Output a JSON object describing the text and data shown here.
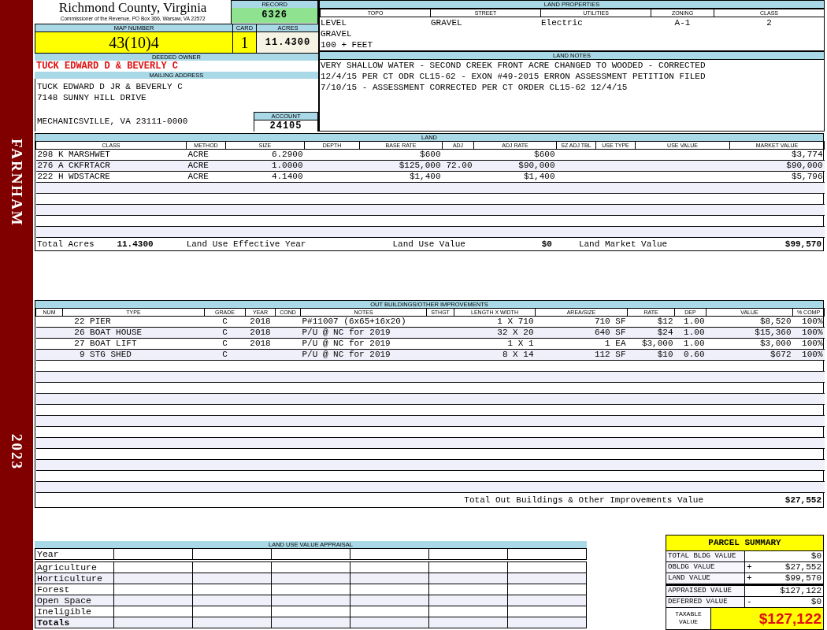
{
  "sidebar": {
    "district": "FARNHAM",
    "year": "2023"
  },
  "header": {
    "county": "Richmond County, Virginia",
    "subtitle": "Commissioner of the Revenue, PO Box 366, Warsaw, VA 22572"
  },
  "record": {
    "label": "RECORD",
    "value": "6326"
  },
  "map_number": {
    "label": "MAP NUMBER",
    "value": "43(10)4"
  },
  "card": {
    "label": "CARD",
    "value": "1"
  },
  "acres": {
    "label": "ACRES",
    "value": "11.4300"
  },
  "deeded_owner": {
    "label": "DEEDED OWNER",
    "value": "TUCK EDWARD D & BEVERLY C"
  },
  "mailing_address": {
    "label": "MAILING ADDRESS",
    "lines": [
      "TUCK EDWARD D JR & BEVERLY C",
      "7148 SUNNY HILL DRIVE"
    ],
    "city_line": "MECHANICSVILLE, VA 23111-0000"
  },
  "account": {
    "label": "ACCOUNT",
    "value": "24105"
  },
  "land_properties": {
    "title": "LAND PROPERTIES",
    "columns": [
      "TOPO",
      "STREET",
      "UTILITIES",
      "ZONING",
      "CLASS"
    ],
    "rows": [
      [
        "LEVEL",
        "GRAVEL",
        "Electric",
        "A-1",
        "2"
      ],
      [
        "GRAVEL"
      ],
      [
        "100 + FEET"
      ]
    ]
  },
  "land_notes": {
    "title": "LAND NOTES",
    "lines": [
      "VERY SHALLOW WATER - SECOND CREEK FRONT ACRE CHANGED TO WOODED - CORRECTED",
      "12/4/15 PER CT ODR CL15-62 - EXON #49-2015 ERRON ASSESSMENT PETITION FILED",
      "7/10/15 - ASSESSMENT CORRECTED PER CT ORDER CL15-62 12/4/15"
    ]
  },
  "land": {
    "title": "LAND",
    "columns": [
      "CLASS",
      "METHOD",
      "SIZE",
      "DEPTH",
      "BASE RATE",
      "ADJ",
      "ADJ RATE",
      "SZ ADJ TBL",
      "USE TYPE",
      "USE VALUE",
      "MARKET VALUE"
    ],
    "rows": [
      {
        "class": "298 K MARSHWET",
        "method": "ACRE",
        "size": "6.2900",
        "base_rate": "$600",
        "adj_rate": "$600",
        "market_value": "$3,774"
      },
      {
        "class": "276 A CKFRTACR",
        "method": "ACRE",
        "size": "1.0000",
        "base_rate": "$125,000",
        "adj": "72.00",
        "adj_rate": "$90,000",
        "market_value": "$90,000"
      },
      {
        "class": "222 H WDSTACRE",
        "method": "ACRE",
        "size": "4.1400",
        "base_rate": "$1,400",
        "adj_rate": "$1,400",
        "market_value": "$5,796"
      }
    ],
    "totals": [
      {
        "label": "Total Acres",
        "value": "11.4300"
      },
      {
        "label": "Land Use Effective Year"
      },
      {
        "label": "Land Use Value",
        "value": "$0"
      },
      {
        "label": "Land Market Value",
        "value": "$99,570"
      }
    ]
  },
  "out_buildings": {
    "title": "OUT BUILDINGS/OTHER IMPROVEMENTS",
    "columns": [
      "NUM",
      "TYPE",
      "GRADE",
      "YEAR",
      "COND",
      "NOTES",
      "STHGT",
      "LENGTH X WIDTH",
      "AREA/SIZE",
      "RATE",
      "DEP",
      "VALUE",
      "% COMP"
    ],
    "rows": [
      {
        "num": "22",
        "type": "PIER",
        "grade": "C",
        "year": "2018",
        "notes": "P#11007 (6x65+16x20)",
        "size": "1 X 710",
        "area": "710 SF",
        "rate": "$12",
        "dep": "1.00",
        "value": "$8,520",
        "comp": "100%"
      },
      {
        "num": "26",
        "type": "BOAT HOUSE",
        "grade": "C",
        "year": "2018",
        "notes": "P/U @ NC for 2019",
        "size": "32 X 20",
        "area": "640 SF",
        "rate": "$24",
        "dep": "1.00",
        "value": "$15,360",
        "comp": "100%"
      },
      {
        "num": "27",
        "type": "BOAT LIFT",
        "grade": "C",
        "year": "2018",
        "notes": "P/U @ NC for 2019",
        "size": "1 X 1",
        "area": "1 EA",
        "rate": "$3,000",
        "dep": "1.00",
        "value": "$3,000",
        "comp": "100%"
      },
      {
        "num": "9",
        "type": "STG SHED",
        "grade": "C",
        "notes": "P/U @ NC for 2019",
        "size": "8 X 14",
        "area": "112 SF",
        "rate": "$10",
        "dep": "0.60",
        "value": "$672",
        "comp": "100%"
      }
    ],
    "total_label": "Total Out Buildings & Other Improvements Value",
    "total_value": "$27,552"
  },
  "land_use_value_appraisal": {
    "title": "LAND USE VALUE APPRAISAL",
    "year_label": "Year",
    "categories": [
      "Agriculture",
      "Horticulture",
      "Forest",
      "Open Space",
      "Ineligible"
    ],
    "totals_label": "Totals"
  },
  "parcel_summary": {
    "title": "PARCEL SUMMARY",
    "rows": [
      {
        "label": "TOTAL BLDG VALUE",
        "sign": "",
        "value": "$0"
      },
      {
        "label": "OBLDG VALUE",
        "sign": "+",
        "value": "$27,552"
      },
      {
        "label": "LAND VALUE",
        "sign": "+",
        "value": "$99,570"
      },
      {
        "label": "APPRAISED VALUE",
        "sign": "",
        "value": "$127,122"
      },
      {
        "label": "DEFERRED VALUE",
        "sign": "-",
        "value": "$0"
      }
    ],
    "taxable_label": "TAXABLE VALUE",
    "taxable_value": "$127,122"
  }
}
